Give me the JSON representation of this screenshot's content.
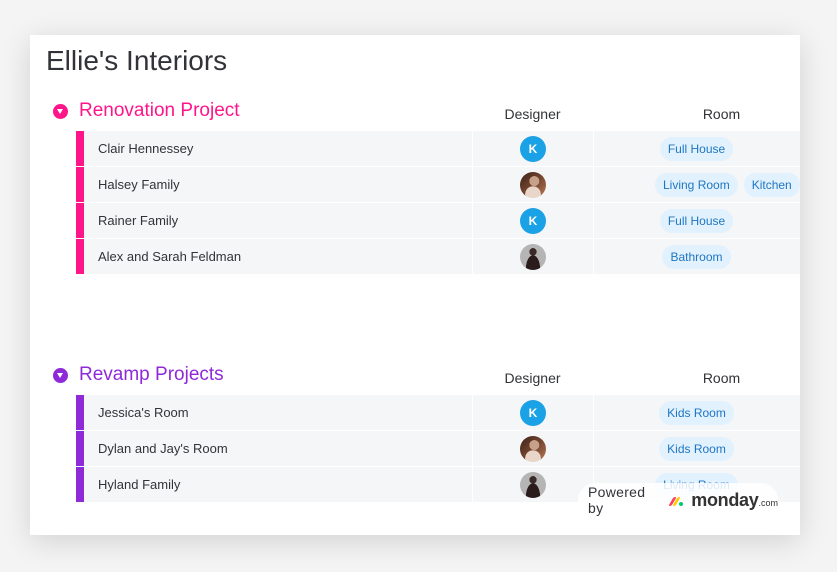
{
  "board": {
    "title": "Ellie's Interiors"
  },
  "columns": {
    "designer": "Designer",
    "room": "Room"
  },
  "colors": {
    "group1": "#ff158a",
    "group2": "#8f2ad8",
    "avatar_initial_bg": "#1ba1e6",
    "tag_bg": "#e1f1fd",
    "tag_text": "#1f76c2"
  },
  "groups": [
    {
      "name": "Renovation Project",
      "rows": [
        {
          "name": "Clair Hennessey",
          "designer": {
            "type": "initial",
            "initial": "K"
          },
          "rooms": [
            "Full House"
          ]
        },
        {
          "name": "Halsey Family",
          "designer": {
            "type": "photo1"
          },
          "rooms": [
            "Living Room",
            "Kitchen"
          ]
        },
        {
          "name": "Rainer Family",
          "designer": {
            "type": "initial",
            "initial": "K"
          },
          "rooms": [
            "Full House"
          ]
        },
        {
          "name": "Alex and Sarah Feldman",
          "designer": {
            "type": "photo2"
          },
          "rooms": [
            "Bathroom"
          ]
        }
      ]
    },
    {
      "name": "Revamp Projects",
      "rows": [
        {
          "name": "Jessica's Room",
          "designer": {
            "type": "initial",
            "initial": "K"
          },
          "rooms": [
            "Kids Room"
          ]
        },
        {
          "name": "Dylan and Jay's Room",
          "designer": {
            "type": "photo1"
          },
          "rooms": [
            "Kids Room"
          ]
        },
        {
          "name": "Hyland Family",
          "designer": {
            "type": "photo2"
          },
          "rooms": [
            "Living Room"
          ]
        }
      ]
    }
  ],
  "footer": {
    "powered_by": "Powered by",
    "brand": "monday",
    "brand_suffix": ".com"
  }
}
